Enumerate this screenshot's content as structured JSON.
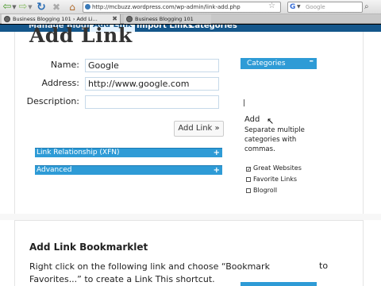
{
  "browser": {
    "url": "http://mcbuzz.wordpress.com/wp-admin/link-add.php",
    "search_placeholder": "Google",
    "tabs": [
      {
        "label": "Business Blogging 101 › Add Li..."
      },
      {
        "label": "Business Blogging 101"
      }
    ]
  },
  "subnav": {
    "items": [
      {
        "label": "Manage Blogroll"
      },
      {
        "label": "Add Link"
      },
      {
        "label": "Import Links"
      },
      {
        "label": "Categories"
      }
    ]
  },
  "form": {
    "title": "Add Link",
    "name_label": "Name:",
    "name_value": "Google",
    "address_label": "Address:",
    "address_value": "http://www.google.com",
    "description_label": "Description:",
    "description_value": "",
    "submit_label": "Add Link »"
  },
  "sections": {
    "xfn_label": "Link Relationship (XFN)",
    "advanced_label": "Advanced"
  },
  "categories": {
    "title": "Categories",
    "add_label": "Add",
    "help_text": "Separate multiple categories with commas.",
    "items": [
      {
        "label": "Great Websites",
        "checked": true
      },
      {
        "label": "Favorite Links",
        "checked": false
      },
      {
        "label": "Blogroll",
        "checked": false
      }
    ]
  },
  "bookmarklet": {
    "title": "Add Link Bookmarklet",
    "text": "Right click on the following link and choose “Bookmark",
    "text_to": "to",
    "text2": "Favorites...” to create a Link This shortcut."
  },
  "colors": {
    "accent": "#2e9bd6",
    "nav": "#14568a"
  }
}
